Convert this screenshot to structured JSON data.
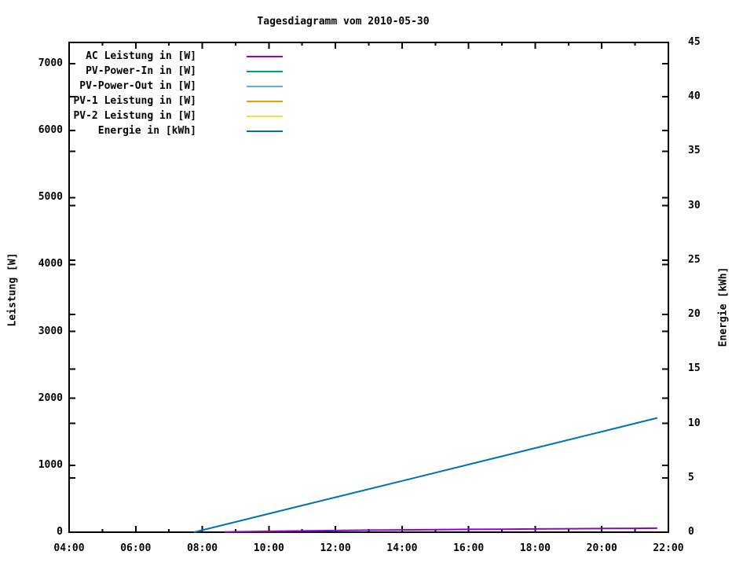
{
  "title": "Tagesdiagramm vom 2010-05-30",
  "axes": {
    "left": {
      "label": "Leistung [W]",
      "ticks": [
        "0",
        "1000",
        "2000",
        "3000",
        "4000",
        "5000",
        "6000",
        "7000"
      ],
      "range": [
        0,
        7000
      ]
    },
    "right": {
      "label": "Energie [kWh]",
      "ticks": [
        "0",
        "5",
        "10",
        "15",
        "20",
        "25",
        "30",
        "35",
        "40",
        "45"
      ],
      "range": [
        0,
        45
      ]
    },
    "bottom": {
      "ticks": [
        "04:00",
        "06:00",
        "08:00",
        "10:00",
        "12:00",
        "14:00",
        "16:00",
        "18:00",
        "20:00",
        "22:00"
      ]
    }
  },
  "legend": {
    "items": [
      {
        "label": "AC Leistung in [W]",
        "color": "#9400d3"
      },
      {
        "label": "PV-Power-In in [W]",
        "color": "#009e73"
      },
      {
        "label": "PV-Power-Out in [W]",
        "color": "#56b4e9"
      },
      {
        "label": "PV-1 Leistung in [W]",
        "color": "#e69f00"
      },
      {
        "label": "PV-2 Leistung in [W]",
        "color": "#f0e442"
      },
      {
        "label": "Energie in [kWh]",
        "color": "#0072b2"
      }
    ]
  },
  "chart_data": {
    "type": "line",
    "title": "Tagesdiagramm vom 2010-05-30",
    "xlabel": "",
    "x_tick_labels": [
      "04:00",
      "06:00",
      "08:00",
      "10:00",
      "12:00",
      "14:00",
      "16:00",
      "18:00",
      "20:00",
      "22:00"
    ],
    "x_range_hours": [
      4,
      22
    ],
    "y_left": {
      "label": "Leistung [W]",
      "range": [
        0,
        7000
      ],
      "tick_step": 1000
    },
    "y_right": {
      "label": "Energie [kWh]",
      "range": [
        0,
        45
      ],
      "tick_step": 5
    },
    "grid": false,
    "legend_position": "top-left-inside",
    "series": [
      {
        "name": "AC Leistung in [W]",
        "axis": "left",
        "color": "#9400d3",
        "visible": true,
        "points": [
          [
            "08:40",
            2
          ],
          [
            "09:00",
            6
          ],
          [
            "10:00",
            13
          ],
          [
            "11:00",
            19
          ],
          [
            "12:00",
            25
          ],
          [
            "13:00",
            30
          ],
          [
            "14:00",
            34
          ],
          [
            "15:00",
            38
          ],
          [
            "16:00",
            42
          ],
          [
            "17:00",
            45
          ],
          [
            "18:00",
            48
          ],
          [
            "19:00",
            52
          ],
          [
            "20:00",
            55
          ],
          [
            "21:00",
            58
          ],
          [
            "21:40",
            60
          ]
        ]
      },
      {
        "name": "PV-Power-In in [W]",
        "axis": "left",
        "color": "#009e73",
        "visible": false,
        "points": []
      },
      {
        "name": "PV-Power-Out in [W]",
        "axis": "left",
        "color": "#56b4e9",
        "visible": false,
        "points": []
      },
      {
        "name": "PV-1 Leistung in [W]",
        "axis": "left",
        "color": "#e69f00",
        "visible": false,
        "points": []
      },
      {
        "name": "PV-2 Leistung in [W]",
        "axis": "left",
        "color": "#f0e442",
        "visible": false,
        "points": []
      },
      {
        "name": "Energie in [kWh]",
        "axis": "right",
        "color": "#0072b2",
        "visible": true,
        "points": [
          [
            "07:45",
            0
          ],
          [
            "08:00",
            0.19
          ],
          [
            "10:00",
            1.7
          ],
          [
            "12:00",
            3.21
          ],
          [
            "14:00",
            4.71
          ],
          [
            "16:00",
            6.22
          ],
          [
            "18:00",
            7.73
          ],
          [
            "20:00",
            9.24
          ],
          [
            "21:40",
            10.5
          ]
        ]
      }
    ]
  }
}
